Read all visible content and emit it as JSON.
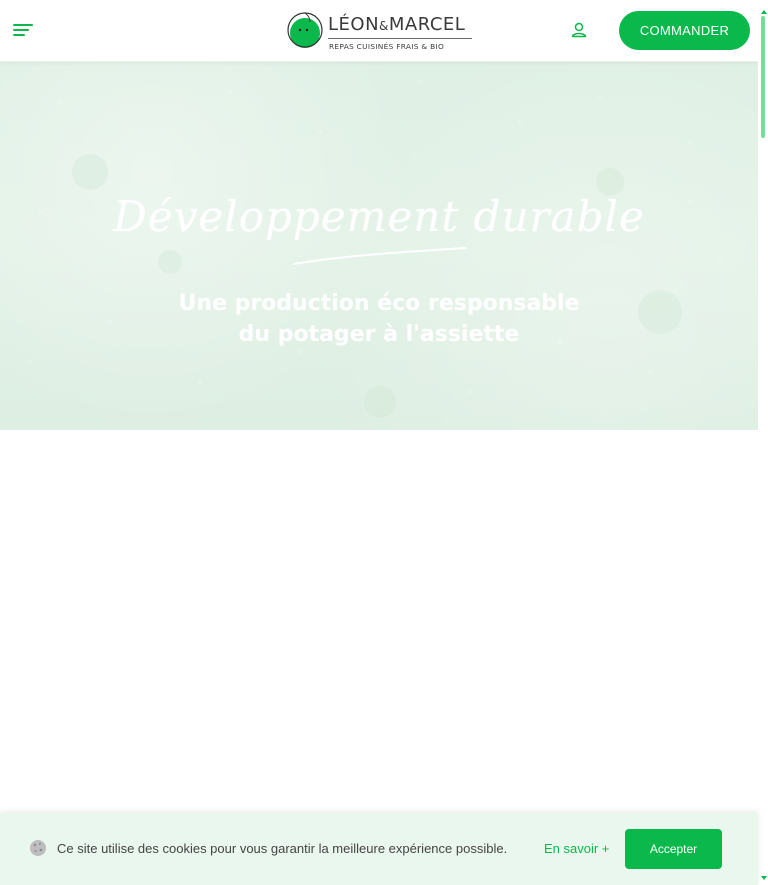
{
  "header": {
    "menu_icon": "hamburger-menu-icon",
    "logo": {
      "name_left": "LÉON",
      "name_amp": "&",
      "name_right": "MARCEL",
      "tagline": "REPAS CUISINÉS FRAIS & BIO"
    },
    "account_icon": "user-icon",
    "order_label": "COMMANDER"
  },
  "hero": {
    "title": "Développement durable",
    "subtitle_line1": "Une production éco responsable",
    "subtitle_line2": "du potager à l'assiette"
  },
  "cookie_banner": {
    "icon": "cookie-icon",
    "text": "Ce site utilise des cookies pour vous garantir la meilleure expérience possible.",
    "link_label": "En savoir +",
    "accept_label": "Accepter"
  },
  "colors": {
    "brand_green": "#0ab84b",
    "hero_bg": "#dff0e4",
    "cookie_bg": "#eaf7ee"
  }
}
